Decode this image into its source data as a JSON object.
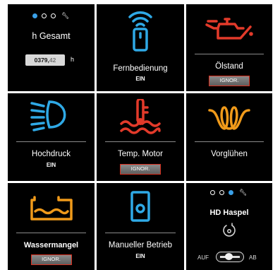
{
  "colors": {
    "blue": "#2fa9e6",
    "red": "#e23a2a",
    "orange": "#f09a1a",
    "active_dot": "#3aa0e8",
    "button_border": "#d8301f"
  },
  "tiles": {
    "operating_hours": {
      "title": "h Gesamt",
      "counter_int": "0379",
      "counter_sep": ",",
      "counter_dec": "42",
      "unit": "h",
      "icon": "wrench-icon"
    },
    "remote": {
      "label": "Fernbedienung",
      "status": "EIN",
      "icon": "remote-control-icon"
    },
    "oil": {
      "label": "Ölstand",
      "button": "IGNOR.",
      "icon": "oil-can-icon"
    },
    "high_pressure": {
      "label": "Hochdruck",
      "status": "EIN",
      "icon": "high-beam-icon"
    },
    "engine_temp": {
      "label": "Temp. Motor",
      "button": "IGNOR.",
      "icon": "coolant-temperature-icon"
    },
    "preglow": {
      "label": "Vorglühen",
      "icon": "glow-plug-icon"
    },
    "water_shortage": {
      "label": "Wassermangel",
      "button": "IGNOR.",
      "icon": "water-tank-icon"
    },
    "manual_mode": {
      "label": "Manueller Betrieb",
      "status": "EIN",
      "icon": "manual-mode-icon"
    },
    "hose_reel": {
      "title": "HD Haspel",
      "left_label": "AUF",
      "right_label": "AB",
      "icon": "hose-reel-icon"
    }
  }
}
